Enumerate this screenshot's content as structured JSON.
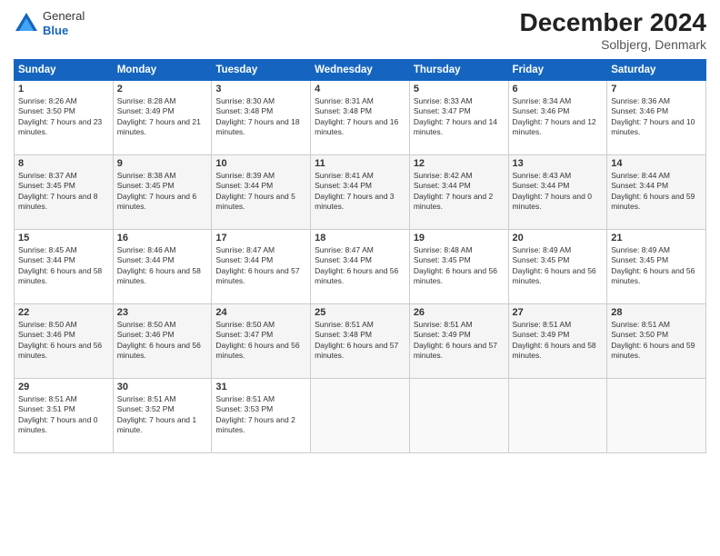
{
  "logo": {
    "line1": "General",
    "line2": "Blue"
  },
  "title": "December 2024",
  "location": "Solbjerg, Denmark",
  "days_of_week": [
    "Sunday",
    "Monday",
    "Tuesday",
    "Wednesday",
    "Thursday",
    "Friday",
    "Saturday"
  ],
  "weeks": [
    [
      {
        "day": "1",
        "sunrise": "Sunrise: 8:26 AM",
        "sunset": "Sunset: 3:50 PM",
        "daylight": "Daylight: 7 hours and 23 minutes."
      },
      {
        "day": "2",
        "sunrise": "Sunrise: 8:28 AM",
        "sunset": "Sunset: 3:49 PM",
        "daylight": "Daylight: 7 hours and 21 minutes."
      },
      {
        "day": "3",
        "sunrise": "Sunrise: 8:30 AM",
        "sunset": "Sunset: 3:48 PM",
        "daylight": "Daylight: 7 hours and 18 minutes."
      },
      {
        "day": "4",
        "sunrise": "Sunrise: 8:31 AM",
        "sunset": "Sunset: 3:48 PM",
        "daylight": "Daylight: 7 hours and 16 minutes."
      },
      {
        "day": "5",
        "sunrise": "Sunrise: 8:33 AM",
        "sunset": "Sunset: 3:47 PM",
        "daylight": "Daylight: 7 hours and 14 minutes."
      },
      {
        "day": "6",
        "sunrise": "Sunrise: 8:34 AM",
        "sunset": "Sunset: 3:46 PM",
        "daylight": "Daylight: 7 hours and 12 minutes."
      },
      {
        "day": "7",
        "sunrise": "Sunrise: 8:36 AM",
        "sunset": "Sunset: 3:46 PM",
        "daylight": "Daylight: 7 hours and 10 minutes."
      }
    ],
    [
      {
        "day": "8",
        "sunrise": "Sunrise: 8:37 AM",
        "sunset": "Sunset: 3:45 PM",
        "daylight": "Daylight: 7 hours and 8 minutes."
      },
      {
        "day": "9",
        "sunrise": "Sunrise: 8:38 AM",
        "sunset": "Sunset: 3:45 PM",
        "daylight": "Daylight: 7 hours and 6 minutes."
      },
      {
        "day": "10",
        "sunrise": "Sunrise: 8:39 AM",
        "sunset": "Sunset: 3:44 PM",
        "daylight": "Daylight: 7 hours and 5 minutes."
      },
      {
        "day": "11",
        "sunrise": "Sunrise: 8:41 AM",
        "sunset": "Sunset: 3:44 PM",
        "daylight": "Daylight: 7 hours and 3 minutes."
      },
      {
        "day": "12",
        "sunrise": "Sunrise: 8:42 AM",
        "sunset": "Sunset: 3:44 PM",
        "daylight": "Daylight: 7 hours and 2 minutes."
      },
      {
        "day": "13",
        "sunrise": "Sunrise: 8:43 AM",
        "sunset": "Sunset: 3:44 PM",
        "daylight": "Daylight: 7 hours and 0 minutes."
      },
      {
        "day": "14",
        "sunrise": "Sunrise: 8:44 AM",
        "sunset": "Sunset: 3:44 PM",
        "daylight": "Daylight: 6 hours and 59 minutes."
      }
    ],
    [
      {
        "day": "15",
        "sunrise": "Sunrise: 8:45 AM",
        "sunset": "Sunset: 3:44 PM",
        "daylight": "Daylight: 6 hours and 58 minutes."
      },
      {
        "day": "16",
        "sunrise": "Sunrise: 8:46 AM",
        "sunset": "Sunset: 3:44 PM",
        "daylight": "Daylight: 6 hours and 58 minutes."
      },
      {
        "day": "17",
        "sunrise": "Sunrise: 8:47 AM",
        "sunset": "Sunset: 3:44 PM",
        "daylight": "Daylight: 6 hours and 57 minutes."
      },
      {
        "day": "18",
        "sunrise": "Sunrise: 8:47 AM",
        "sunset": "Sunset: 3:44 PM",
        "daylight": "Daylight: 6 hours and 56 minutes."
      },
      {
        "day": "19",
        "sunrise": "Sunrise: 8:48 AM",
        "sunset": "Sunset: 3:45 PM",
        "daylight": "Daylight: 6 hours and 56 minutes."
      },
      {
        "day": "20",
        "sunrise": "Sunrise: 8:49 AM",
        "sunset": "Sunset: 3:45 PM",
        "daylight": "Daylight: 6 hours and 56 minutes."
      },
      {
        "day": "21",
        "sunrise": "Sunrise: 8:49 AM",
        "sunset": "Sunset: 3:45 PM",
        "daylight": "Daylight: 6 hours and 56 minutes."
      }
    ],
    [
      {
        "day": "22",
        "sunrise": "Sunrise: 8:50 AM",
        "sunset": "Sunset: 3:46 PM",
        "daylight": "Daylight: 6 hours and 56 minutes."
      },
      {
        "day": "23",
        "sunrise": "Sunrise: 8:50 AM",
        "sunset": "Sunset: 3:46 PM",
        "daylight": "Daylight: 6 hours and 56 minutes."
      },
      {
        "day": "24",
        "sunrise": "Sunrise: 8:50 AM",
        "sunset": "Sunset: 3:47 PM",
        "daylight": "Daylight: 6 hours and 56 minutes."
      },
      {
        "day": "25",
        "sunrise": "Sunrise: 8:51 AM",
        "sunset": "Sunset: 3:48 PM",
        "daylight": "Daylight: 6 hours and 57 minutes."
      },
      {
        "day": "26",
        "sunrise": "Sunrise: 8:51 AM",
        "sunset": "Sunset: 3:49 PM",
        "daylight": "Daylight: 6 hours and 57 minutes."
      },
      {
        "day": "27",
        "sunrise": "Sunrise: 8:51 AM",
        "sunset": "Sunset: 3:49 PM",
        "daylight": "Daylight: 6 hours and 58 minutes."
      },
      {
        "day": "28",
        "sunrise": "Sunrise: 8:51 AM",
        "sunset": "Sunset: 3:50 PM",
        "daylight": "Daylight: 6 hours and 59 minutes."
      }
    ],
    [
      {
        "day": "29",
        "sunrise": "Sunrise: 8:51 AM",
        "sunset": "Sunset: 3:51 PM",
        "daylight": "Daylight: 7 hours and 0 minutes."
      },
      {
        "day": "30",
        "sunrise": "Sunrise: 8:51 AM",
        "sunset": "Sunset: 3:52 PM",
        "daylight": "Daylight: 7 hours and 1 minute."
      },
      {
        "day": "31",
        "sunrise": "Sunrise: 8:51 AM",
        "sunset": "Sunset: 3:53 PM",
        "daylight": "Daylight: 7 hours and 2 minutes."
      },
      null,
      null,
      null,
      null
    ]
  ]
}
